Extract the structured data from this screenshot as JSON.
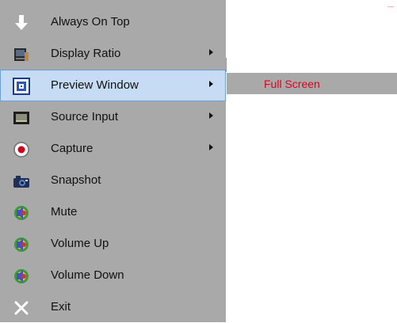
{
  "menu": {
    "items": [
      {
        "label": "Always On Top",
        "icon": "arrow-down-icon",
        "submenu": false
      },
      {
        "label": "Display Ratio",
        "icon": "display-ratio-icon",
        "submenu": true
      },
      {
        "label": "Preview Window",
        "icon": "preview-window-icon",
        "submenu": true,
        "selected": true
      },
      {
        "label": "Source Input",
        "icon": "source-input-icon",
        "submenu": true
      },
      {
        "label": "Capture",
        "icon": "record-icon",
        "submenu": true
      },
      {
        "label": "Snapshot",
        "icon": "camera-icon",
        "submenu": false
      },
      {
        "label": "Mute",
        "icon": "speaker-icon",
        "submenu": false
      },
      {
        "label": "Volume Up",
        "icon": "speaker-icon",
        "submenu": false
      },
      {
        "label": "Volume Down",
        "icon": "speaker-icon",
        "submenu": false
      },
      {
        "label": "Exit",
        "icon": "close-icon",
        "submenu": false
      }
    ]
  },
  "submenu": {
    "items": [
      {
        "label": "Full Screen"
      }
    ]
  },
  "colors": {
    "menu_background": "#a9a9a9",
    "selected_background": "#c6dcf5",
    "selected_border": "#6a9fd8",
    "submenu_text": "#e2001a"
  }
}
